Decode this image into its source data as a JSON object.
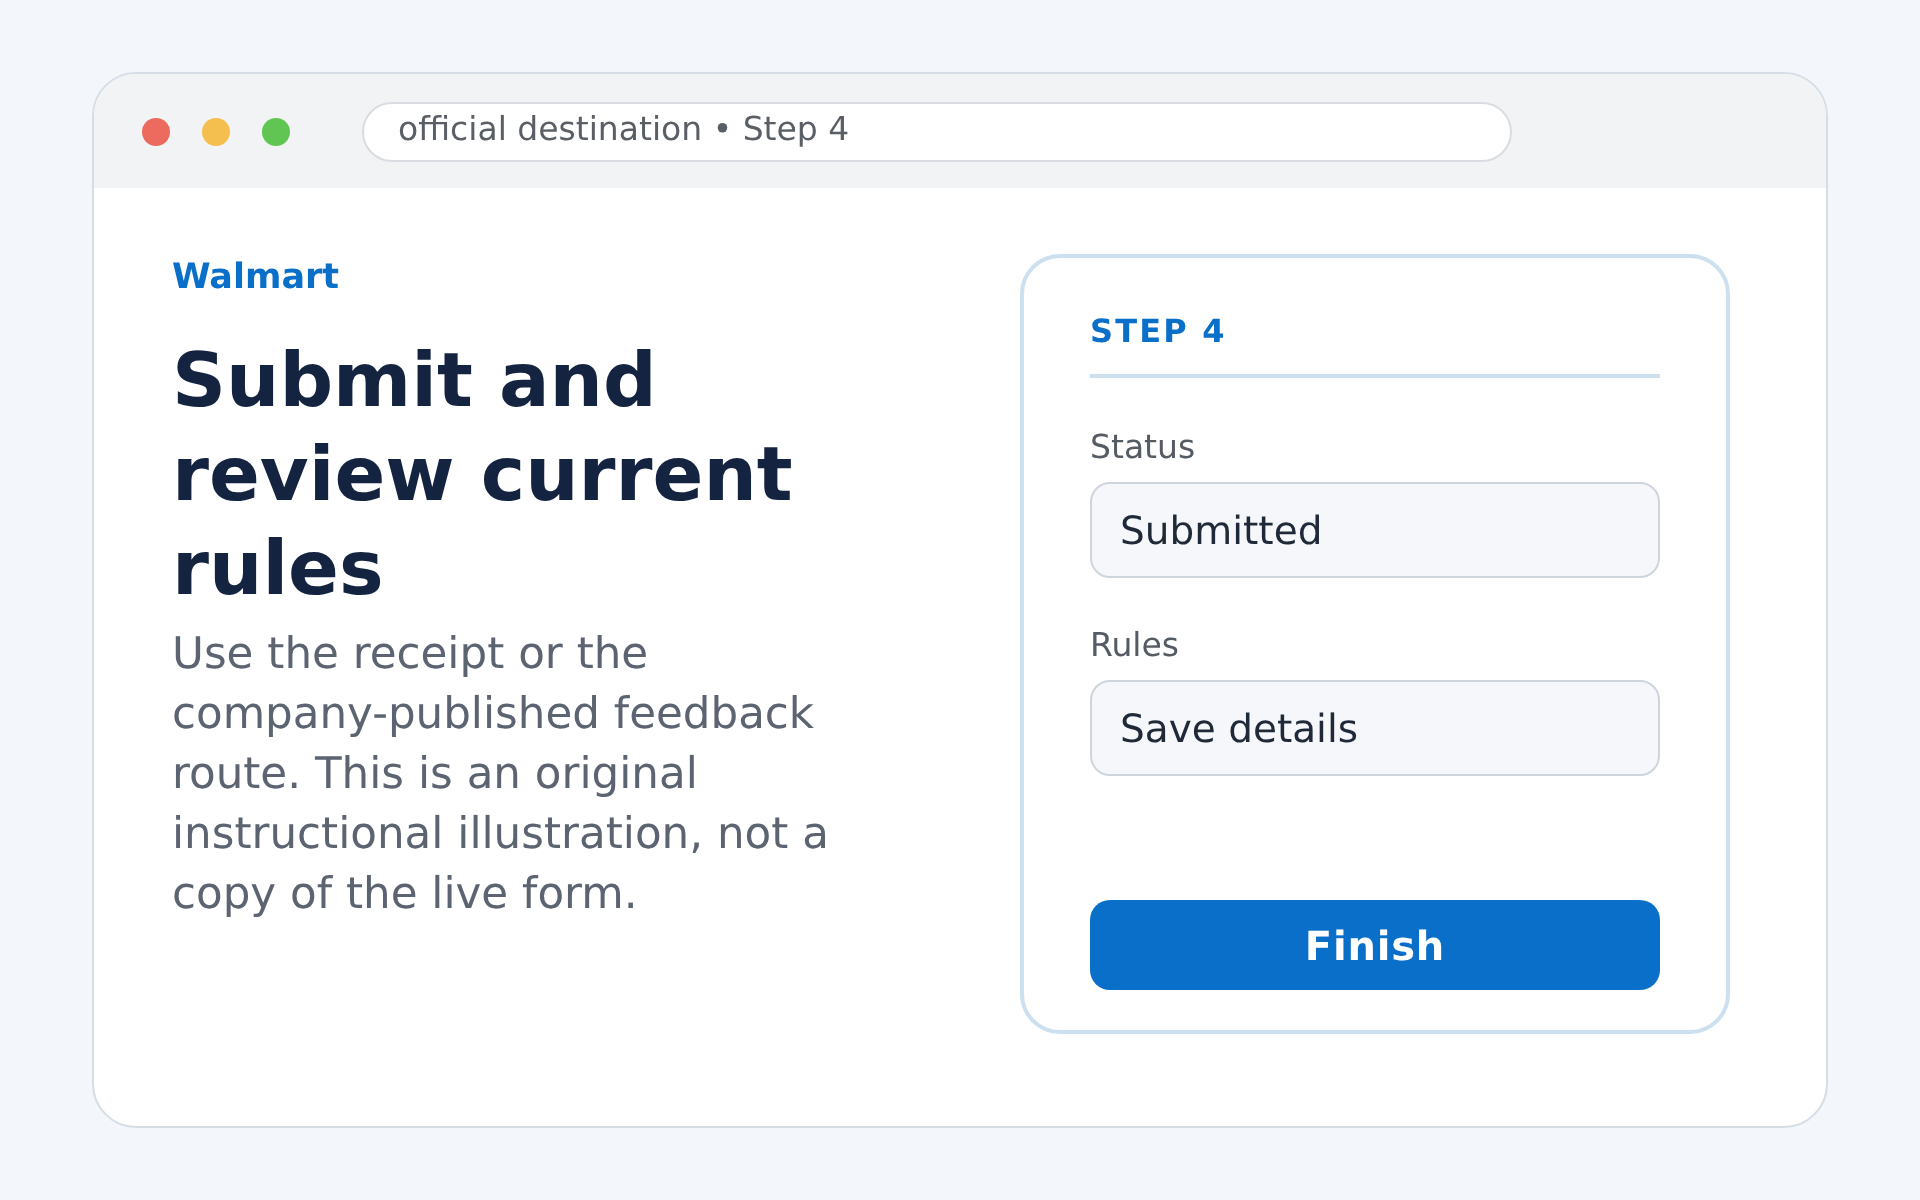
{
  "window": {
    "address_bar": "official destination • Step 4"
  },
  "intro": {
    "brand": "Walmart",
    "title": "Submit and review current rules",
    "description": "Use the receipt or the company-published feedback route. This is an original instructional illustration, not a copy of the live form."
  },
  "form_card": {
    "step_label": "STEP 4",
    "fields": [
      {
        "label": "Status",
        "value": "Submitted"
      },
      {
        "label": "Rules",
        "value": "Save details"
      }
    ],
    "button": "Finish"
  }
}
